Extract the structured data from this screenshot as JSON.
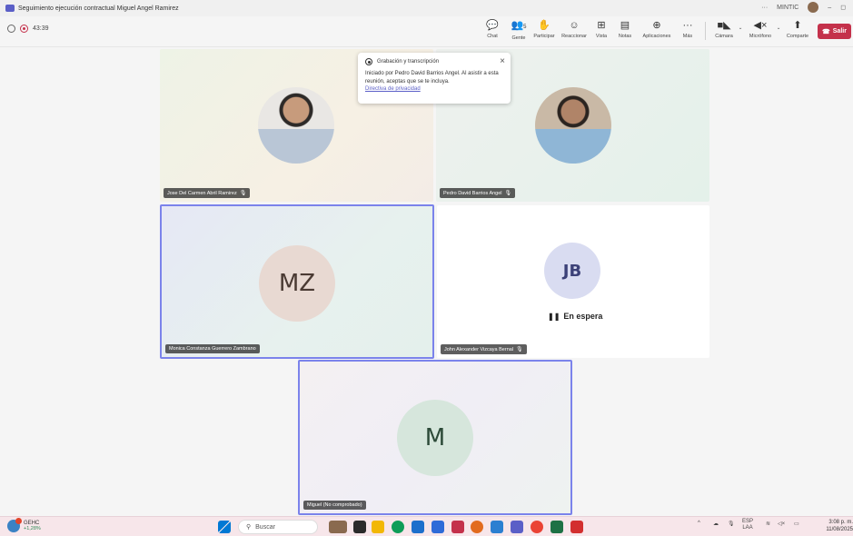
{
  "titlebar": {
    "title": "Seguimiento ejecución contractual Miguel Angel Ramirez",
    "org": "MINTIC"
  },
  "toolbar": {
    "timer": "43:39",
    "chat": "Chat",
    "people": "Gente",
    "people_count": "5",
    "raise": "Participar",
    "react": "Reaccionar",
    "view": "Vista",
    "notes": "Notas",
    "apps": "Aplicaciones",
    "more": "Más",
    "camera": "Cámara",
    "mic": "Micrófono",
    "share": "Comparte",
    "leave": "Salir"
  },
  "popup": {
    "title": "Grabación y transcripción",
    "body": "Iniciado por Pedro David Barrios Angel. Al asistir a esta reunión, aceptas que se te incluya.",
    "link": "Directiva de privacidad"
  },
  "participants": [
    {
      "name": "Jose Del Carmen Abril Ramirez"
    },
    {
      "name": "Pedro David Barrios Angel"
    },
    {
      "name": "Monica Constanza Guerrero Zambrano",
      "initials": "MZ"
    },
    {
      "name": "John Alexander Vizcaya Bernal",
      "initials": "JB",
      "status": "En espera"
    },
    {
      "name": "Miguel (No comprobado)",
      "initials": "M"
    }
  ],
  "taskbar": {
    "weather_label": "GEHC",
    "weather_change": "+1,28%",
    "search": "Buscar",
    "lang": "ESP",
    "lang_sub": "LAA",
    "time": "3:08 p. m.",
    "date": "11/08/2025"
  },
  "colors": {
    "accent": "#5b5fc7",
    "leave": "#c4314b",
    "active_border": "#7b83eb"
  }
}
